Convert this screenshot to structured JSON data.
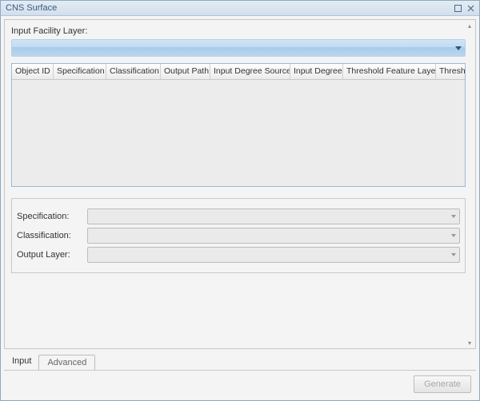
{
  "window": {
    "title": "CNS Surface"
  },
  "input_facility": {
    "label": "Input Facility Layer:",
    "value": ""
  },
  "grid": {
    "columns": [
      "Object ID",
      "Specification",
      "Classification",
      "Output Path",
      "Input Degree Source",
      "Input Degree",
      "Threshold Feature Layer",
      "Threshold Feature ID"
    ]
  },
  "form": {
    "specification": {
      "label": "Specification:",
      "value": ""
    },
    "classification": {
      "label": "Classification:",
      "value": ""
    },
    "output_layer": {
      "label": "Output Layer:",
      "value": ""
    }
  },
  "tabs": {
    "input": "Input",
    "advanced": "Advanced"
  },
  "buttons": {
    "generate": "Generate"
  }
}
